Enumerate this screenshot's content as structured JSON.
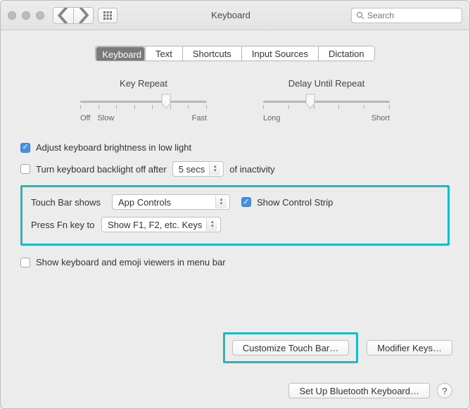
{
  "window": {
    "title": "Keyboard"
  },
  "search": {
    "placeholder": "Search",
    "value": ""
  },
  "tabs": [
    "Keyboard",
    "Text",
    "Shortcuts",
    "Input Sources",
    "Dictation"
  ],
  "selected_tab": 0,
  "sliders": {
    "key_repeat": {
      "title": "Key Repeat",
      "left": "Off",
      "left2": "Slow",
      "right": "Fast",
      "pos": 0.68
    },
    "delay": {
      "title": "Delay Until Repeat",
      "left": "Long",
      "right": "Short",
      "pos": 0.37
    }
  },
  "checks": {
    "brightness": {
      "label": "Adjust keyboard brightness in low light",
      "checked": true
    },
    "backlight_off": {
      "label_before": "Turn keyboard backlight off after",
      "label_after": "of inactivity",
      "checked": false,
      "value": "5 secs"
    },
    "control_strip": {
      "label": "Show Control Strip",
      "checked": true
    },
    "viewers": {
      "label": "Show keyboard and emoji viewers in menu bar",
      "checked": false
    }
  },
  "touchbar": {
    "label": "Touch Bar shows",
    "value": "App Controls"
  },
  "fn": {
    "label": "Press Fn key to",
    "value": "Show F1, F2, etc. Keys"
  },
  "buttons": {
    "customize": "Customize Touch Bar…",
    "modifier": "Modifier Keys…",
    "bluetooth": "Set Up Bluetooth Keyboard…",
    "help": "?"
  }
}
